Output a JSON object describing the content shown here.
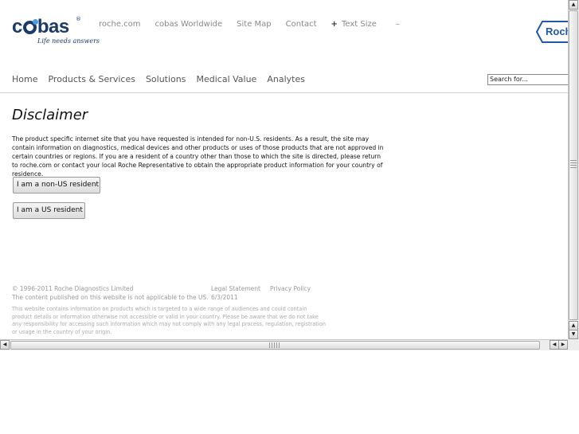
{
  "header": {
    "logo_text": "cobas",
    "logo_tagline": "Life needs answers",
    "roche_logo_text": "Roche",
    "top_links": [
      "roche.com",
      "cobas Worldwide",
      "Site Map",
      "Contact"
    ],
    "text_size_label": "Text Size",
    "text_size_plus": "+",
    "text_size_minus": "–"
  },
  "nav": {
    "items": [
      "Home",
      "Products & Services",
      "Solutions",
      "Medical Value",
      "Analytes"
    ],
    "search_placeholder": "Search for..."
  },
  "main": {
    "title": "Disclaimer",
    "paragraph": "The product specific internet site that you have requested is intended for non-U.S. residents. As a result, the site may contain information on diagnostics, medical devices and other products or uses of those products that are not approved in certain countries or regions. If you are a resident of a country other than those to which the site is directed, please return to roche.com or contact your local Roche Representative to obtain the appropriate product information for your country of residence.",
    "btn_non_us": "I am a non-US resident",
    "btn_us": "I am a US resident"
  },
  "footer": {
    "copyright": "© 1996-2011 Roche Diagnostics Limited",
    "content_note": "The content published on this website is not applicable to the US.",
    "legal_statement": "Legal Statement",
    "privacy_policy": "Privacy Policy",
    "date": "6/3/2011",
    "notice": "This website contains information on products which is targeted to a wide range of audiences and could contain product details or information otherwise not accessible or valid in your country. Please be aware that we do not take any responsibility for accessing such information which may not comply with any legal process, regulation, registration or usage in the country of your origin."
  },
  "scrollbar": {
    "up": "▲",
    "down": "▼",
    "left": "◀",
    "right": "▶"
  }
}
